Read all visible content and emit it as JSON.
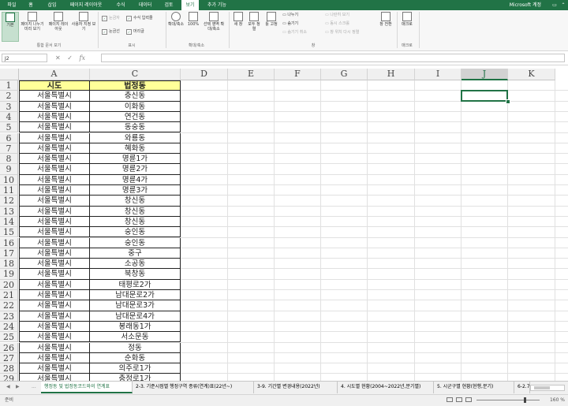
{
  "menu": {
    "tabs": [
      "파일",
      "홈",
      "삽입",
      "페이지 레이아웃",
      "수식",
      "데이터",
      "검토",
      "보기",
      "추가 기능"
    ],
    "active_index": 7,
    "account": "Microsoft 계정"
  },
  "ribbon": {
    "workbook_views": {
      "buttons": [
        "기본",
        "페이지 나누기 미리 보기",
        "페이지 레이아웃",
        "사용자 지정 보기"
      ],
      "group_name": "통합 문서 보기"
    },
    "show": {
      "items": [
        {
          "label": "눈금자",
          "checked": true,
          "disabled": true
        },
        {
          "label": "수식 입력줄",
          "checked": true,
          "disabled": false
        },
        {
          "label": "눈금선",
          "checked": true,
          "disabled": false
        },
        {
          "label": "머리글",
          "checked": true,
          "disabled": false
        }
      ],
      "group_name": "표시"
    },
    "zoom": {
      "buttons": [
        "확대/축소",
        "100%",
        "선택 영역 확대/축소"
      ],
      "group_name": "확대/축소"
    },
    "window": {
      "buttons": [
        "새 창",
        "모두 정렬",
        "틀 고정"
      ],
      "small": [
        {
          "label": "나누기",
          "disabled": false
        },
        {
          "label": "숨기기",
          "disabled": false
        },
        {
          "label": "숨기기 취소",
          "disabled": true
        },
        {
          "label": "나란히 보기",
          "disabled": true
        },
        {
          "label": "동시 스크롤",
          "disabled": true
        },
        {
          "label": "창 위치 다시 정렬",
          "disabled": true
        }
      ],
      "switch_label": "창 전환",
      "group_name": "창"
    },
    "macros": {
      "button": "매크로",
      "group_name": "매크로"
    }
  },
  "formula_bar": {
    "name_box": "J2",
    "formula": ""
  },
  "columns": [
    "A",
    "C",
    "D",
    "E",
    "F",
    "G",
    "H",
    "I",
    "J",
    "K"
  ],
  "selected_column": "J",
  "table": {
    "headers": [
      "시도",
      "법정동"
    ],
    "rows": [
      [
        "서울특별시",
        "충신동"
      ],
      [
        "서울특별시",
        "이화동"
      ],
      [
        "서울특별시",
        "연건동"
      ],
      [
        "서울특별시",
        "동숭동"
      ],
      [
        "서울특별시",
        "와룡동"
      ],
      [
        "서울특별시",
        "혜화동"
      ],
      [
        "서울특별시",
        "명륜1가"
      ],
      [
        "서울특별시",
        "명륜2가"
      ],
      [
        "서울특별시",
        "명륜4가"
      ],
      [
        "서울특별시",
        "명륜3가"
      ],
      [
        "서울특별시",
        "창신동"
      ],
      [
        "서울특별시",
        "창신동"
      ],
      [
        "서울특별시",
        "창신동"
      ],
      [
        "서울특별시",
        "숭인동"
      ],
      [
        "서울특별시",
        "숭인동"
      ],
      [
        "서울특별시",
        "중구"
      ],
      [
        "서울특별시",
        "소공동"
      ],
      [
        "서울특별시",
        "북창동"
      ],
      [
        "서울특별시",
        "태평로2가"
      ],
      [
        "서울특별시",
        "남대문로2가"
      ],
      [
        "서울특별시",
        "남대문로3가"
      ],
      [
        "서울특별시",
        "남대문로4가"
      ],
      [
        "서울특별시",
        "봉래동1가"
      ],
      [
        "서울특별시",
        "서소문동"
      ],
      [
        "서울특별시",
        "정동"
      ],
      [
        "서울특별시",
        "순화동"
      ],
      [
        "서울특별시",
        "의주로1가"
      ],
      [
        "서울특별시",
        "충정로1가"
      ]
    ]
  },
  "row_numbers": [
    "1",
    "2",
    "3",
    "4",
    "5",
    "6",
    "7",
    "8",
    "9",
    "10",
    "11",
    "12",
    "13",
    "14",
    "15",
    "16",
    "17",
    "18",
    "19",
    "20",
    "21",
    "22",
    "23",
    "24",
    "25",
    "26",
    "27",
    "28",
    "29"
  ],
  "sheet_tabs": {
    "ellipsis": "...",
    "tabs": [
      "행정동 및 법정동코드와의 연계표",
      "2-3. 기준시점별 행정구역 종류(연계)표(22년~)",
      "3-9. 기간별 변경내용(2022년)",
      "4. 시도별 현황(2004~2022년,분기별)",
      "5. 시군구별 현황(현행,분기)",
      "6-2.7 ..."
    ],
    "active_index": 0
  },
  "status": {
    "ready": "준비",
    "zoom": "160 %"
  },
  "colors": {
    "excel_green": "#217346",
    "header_fill": "#ffff99"
  }
}
